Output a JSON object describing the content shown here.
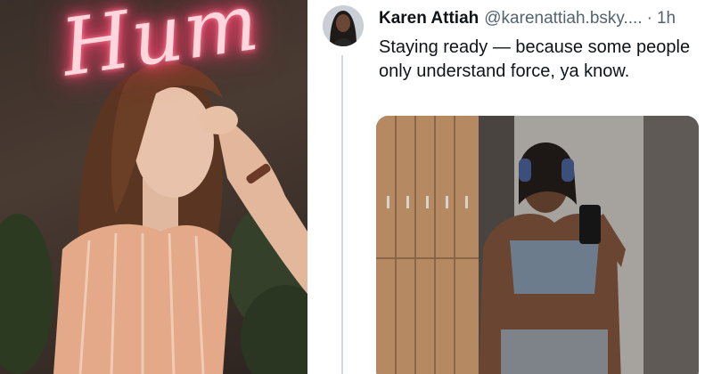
{
  "left_photo": {
    "neon_sign_text": "Hum",
    "description_icon": "woman-photo"
  },
  "tweet": {
    "author_name": "Karen Attiah",
    "author_handle": "@karenattiah.bsky....",
    "separator": "·",
    "timestamp": "1h",
    "text": "Staying ready — because some people only understand force, ya know.",
    "avatar_icon": "avatar-photo",
    "media_icon": "gym-selfie-photo"
  },
  "colors": {
    "neon_pink": "#ff4f77",
    "text_primary": "#0f1419",
    "text_secondary": "#536471",
    "thread_line": "#cfd9de"
  }
}
